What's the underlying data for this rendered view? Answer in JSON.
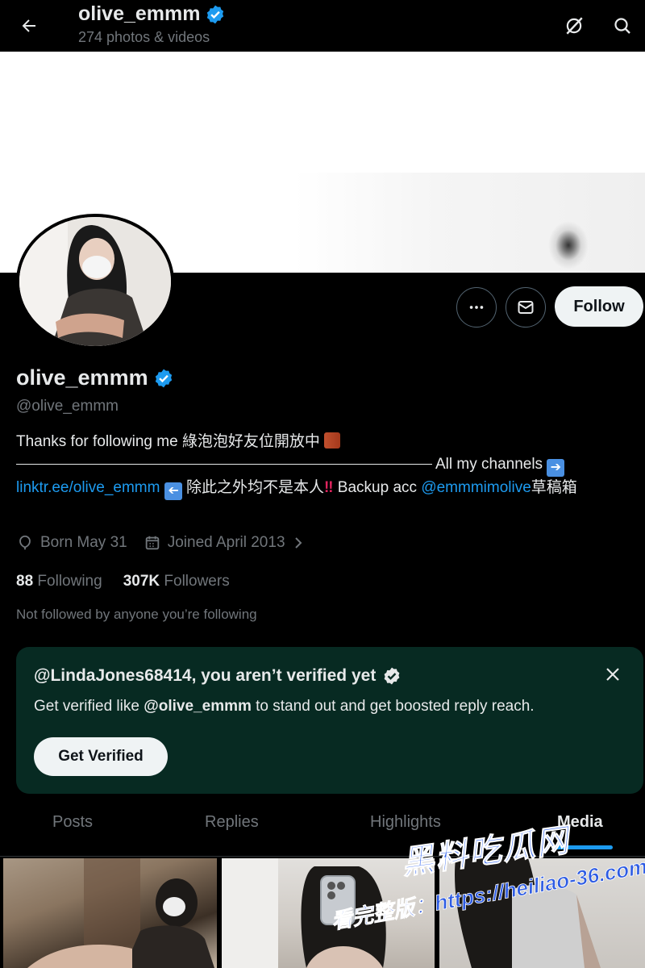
{
  "header": {
    "title": "olive_emmm",
    "subtitle": "274 photos & videos"
  },
  "profile": {
    "name": "olive_emmm",
    "handle": "@olive_emmm",
    "bio": {
      "line1": "Thanks for following me 綠泡泡好友位開放中",
      "channels_label": "All my channels",
      "link": "linktr.ee/olive_emmm",
      "middle": "除此之外均不是本人",
      "backup_label": "Backup acc",
      "backup_handle": "@emmmimolive",
      "tail": "草稿箱"
    },
    "birthday": "Born May 31",
    "joined": "Joined April 2013",
    "following_count": "88",
    "following_label": "Following",
    "followers_count": "307K",
    "followers_label": "Followers",
    "not_followed": "Not followed by anyone you’re following"
  },
  "actions": {
    "follow_label": "Follow"
  },
  "verify_card": {
    "title": "@LindaJones68414, you aren’t verified yet",
    "text_prefix": "Get verified like",
    "text_handle": "@olive_emmm",
    "text_suffix": "to stand out and get boosted reply reach.",
    "button_label": "Get Verified"
  },
  "tabs": [
    {
      "label": "Posts"
    },
    {
      "label": "Replies"
    },
    {
      "label": "Highlights"
    },
    {
      "label": "Media"
    }
  ],
  "watermark": {
    "brand": "黑料吃瓜网",
    "text": "看完整版：https://heiliao-36.com"
  },
  "colors": {
    "accent": "#1d9bf0",
    "background": "#000000",
    "card": "#072a22",
    "muted": "#71767b"
  }
}
